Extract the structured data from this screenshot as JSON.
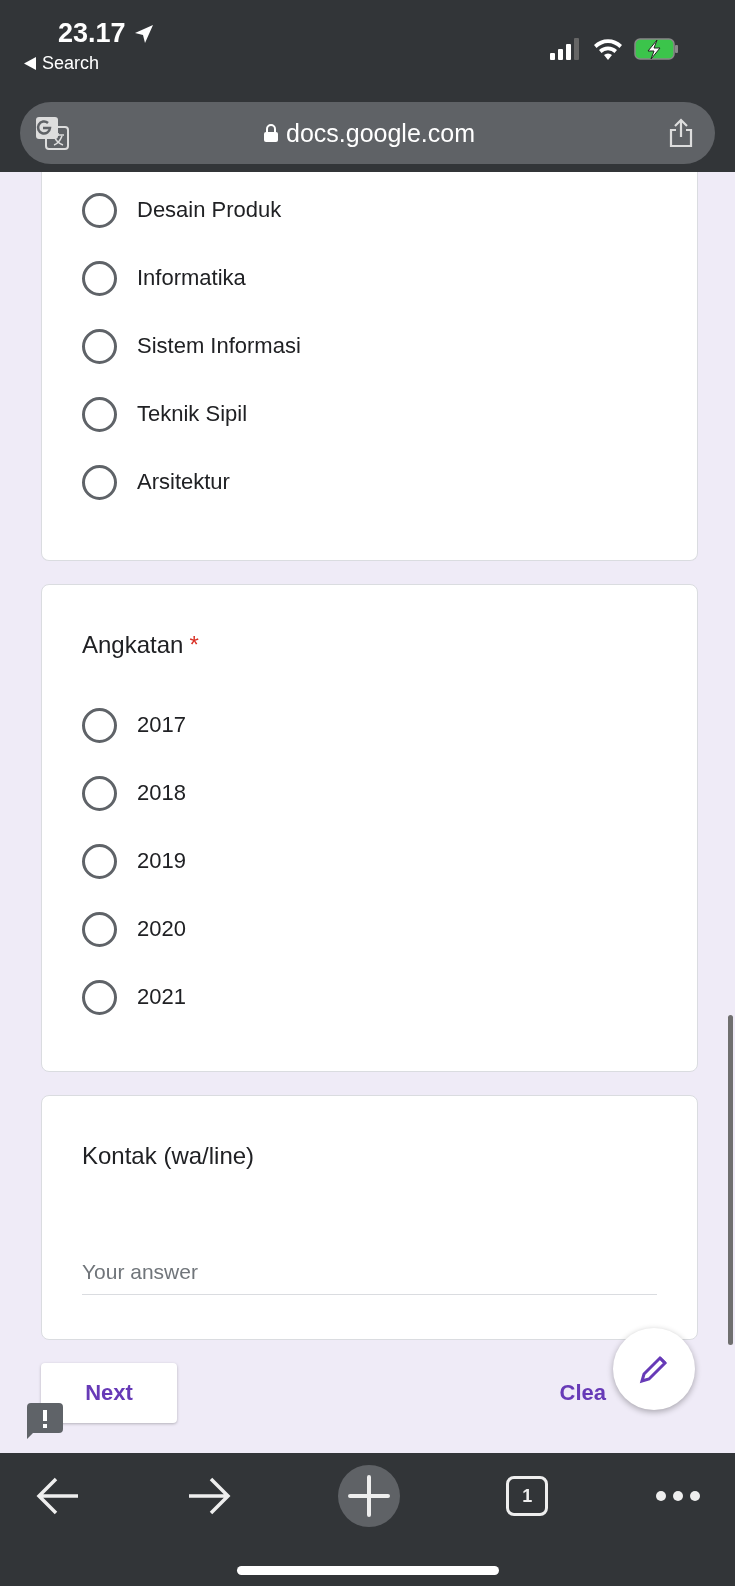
{
  "status_bar": {
    "time": "23.17",
    "back_label": "Search"
  },
  "address_bar": {
    "url": "docs.google.com"
  },
  "questions": [
    {
      "kind": "radio",
      "options": [
        {
          "label": "Desain Produk",
          "selected": false
        },
        {
          "label": "Informatika",
          "selected": false
        },
        {
          "label": "Sistem Informasi",
          "selected": false
        },
        {
          "label": "Teknik Sipil",
          "selected": false
        },
        {
          "label": "Arsitektur",
          "selected": false
        }
      ]
    },
    {
      "kind": "radio",
      "title": "Angkatan",
      "required_mark": "*",
      "options": [
        {
          "label": "2017",
          "selected": false
        },
        {
          "label": "2018",
          "selected": false
        },
        {
          "label": "2019",
          "selected": false
        },
        {
          "label": "2020",
          "selected": false
        },
        {
          "label": "2021",
          "selected": false
        }
      ]
    },
    {
      "kind": "text",
      "title": "Kontak (wa/line)",
      "placeholder": "Your answer"
    }
  ],
  "buttons": {
    "next": "Next",
    "clear": "Clea"
  },
  "toolbar": {
    "tab_count": "1"
  }
}
